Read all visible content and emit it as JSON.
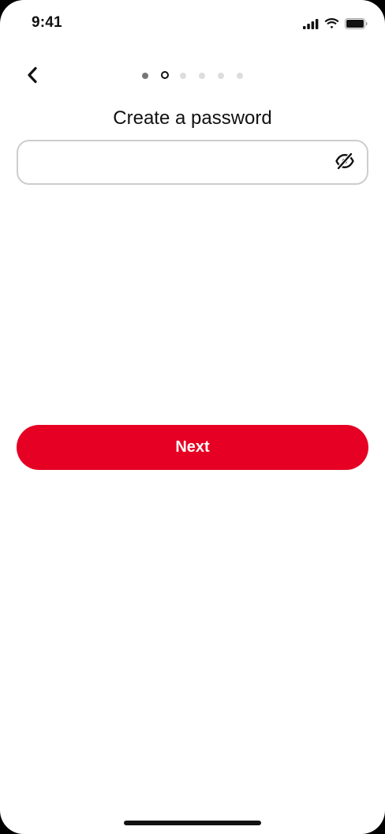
{
  "status_bar": {
    "time": "9:41",
    "icons": [
      "cellular-signal-icon",
      "wifi-icon",
      "battery-icon"
    ]
  },
  "header": {
    "back_icon": "chevron-left-icon",
    "progress": {
      "total_steps": 6,
      "current_step": 2
    }
  },
  "main": {
    "title": "Create a password",
    "password_field": {
      "value": "",
      "placeholder": "",
      "toggle_icon": "eye-slash-icon"
    },
    "next_label": "Next"
  },
  "colors": {
    "brand_red": "#e60023",
    "text": "#111111",
    "field_border": "#cdcdcd",
    "dot_done": "#767676",
    "dot_upcoming": "#dddddd"
  }
}
